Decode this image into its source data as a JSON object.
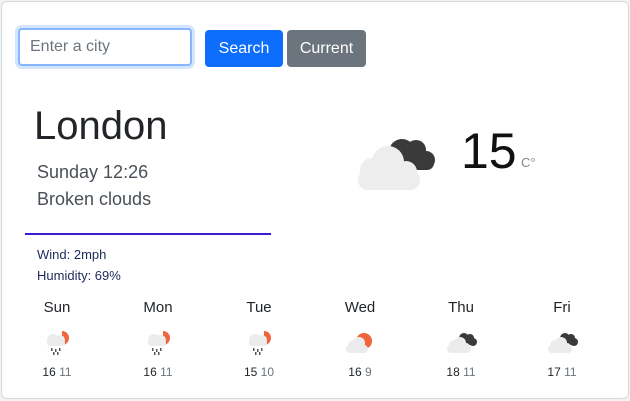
{
  "search": {
    "placeholder": "Enter a city",
    "value": ""
  },
  "buttons": {
    "search_label": "Search",
    "current_label": "Current"
  },
  "current": {
    "city": "London",
    "datetime": "Sunday 12:26",
    "condition": "Broken clouds",
    "wind": "Wind: 2mph",
    "humidity": "Humidity: 69%",
    "temperature": "15",
    "unit": "C°",
    "icon": "broken-clouds-icon"
  },
  "forecast": [
    {
      "day": "Sun",
      "high": "16",
      "low": "11",
      "icon": "rain-sun-icon"
    },
    {
      "day": "Mon",
      "high": "16",
      "low": "11",
      "icon": "rain-sun-icon"
    },
    {
      "day": "Tue",
      "high": "15",
      "low": "10",
      "icon": "rain-sun-icon"
    },
    {
      "day": "Wed",
      "high": "16",
      "low": "9",
      "icon": "sun-cloud-icon"
    },
    {
      "day": "Thu",
      "high": "18",
      "low": "11",
      "icon": "broken-clouds-icon"
    },
    {
      "day": "Fri",
      "high": "17",
      "low": "11",
      "icon": "broken-clouds-icon"
    }
  ],
  "colors": {
    "primary": "#0d6efd",
    "secondary": "#6c757d",
    "divider": "#3d18d6",
    "sun": "#f0643c"
  }
}
